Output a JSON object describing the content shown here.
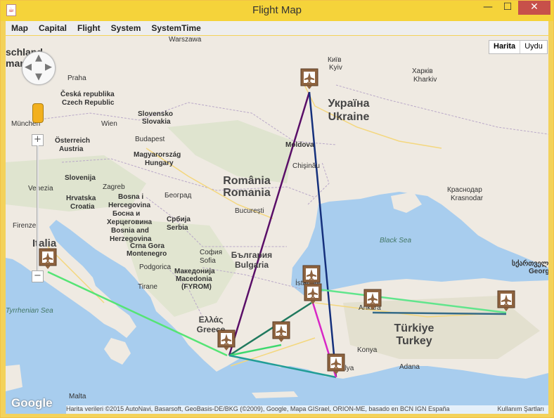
{
  "window": {
    "title": "Flight Map",
    "app_icon": "java-icon"
  },
  "menu": [
    "Map",
    "Capital",
    "Flight",
    "System",
    "SystemTime"
  ],
  "map_type": {
    "map_label": "Harita",
    "satellite_label": "Uydu"
  },
  "google_logo": "Google",
  "attribution": "Harita verileri ©2015 AutoNavi, Basarsoft, GeoBasis-DE/BKG (©2009), Google, Mapa GISrael, ORION-ME, basado en BCN IGN España",
  "terms": "Kullanım Şartları",
  "countries": [
    {
      "l1": "Україна",
      "l2": "Ukraine"
    },
    {
      "l1": "România",
      "l2": "Romania"
    },
    {
      "l1": "България",
      "l2": "Bulgaria"
    },
    {
      "l1": "Türkiye",
      "l2": "Turkey"
    },
    {
      "l1": "Ελλάς",
      "l2": "Greece"
    },
    {
      "l1": "Italia",
      "l2": ""
    }
  ],
  "cities": [
    "Warszawa",
    "Київ",
    "Kyiv",
    "Харків",
    "Kharkiv",
    "Praha",
    "Česká republika",
    "Czech Republic",
    "Slovensko",
    "Slovakia",
    "Wien",
    "Österreich",
    "Austria",
    "München",
    "Budapest",
    "Magyarország",
    "Hungary",
    "Moldova",
    "Chişinău",
    "Slovenija",
    "Zagreb",
    "Hrvatska",
    "Croatia",
    "Bosna i",
    "Hercegovina",
    "Босна и",
    "Херцеговина",
    "Bosnia and",
    "Herzegovina",
    "Београд",
    "Србија",
    "Serbia",
    "Crna Gora",
    "Montenegro",
    "Podgorica",
    "București",
    "Краснодар",
    "Krasnodar",
    "Black Sea",
    "София",
    "Sofia",
    "Македонија",
    "Macedonia",
    "(FYROM)",
    "Tirane",
    "Venezia",
    "Firenze",
    "İstanbul",
    "Ankara",
    "Konya",
    "Antalya",
    "Adana",
    "Malta",
    "Tyrrhenian Sea",
    "Georgia",
    "სქართველო",
    "schland",
    "many"
  ],
  "airports": [
    "Kyiv",
    "Roma",
    "İstanbul",
    "İstanbul",
    "Ankara",
    "Erzurum",
    "İzmir",
    "Atina",
    "Antalya"
  ],
  "flights": [
    {
      "from": "Kyiv",
      "to": "Atina",
      "color": "#5a0f68"
    },
    {
      "from": "Kyiv",
      "to": "Antalya",
      "color": "#15307c"
    },
    {
      "from": "Roma",
      "to": "Atina",
      "color": "#55e475"
    },
    {
      "from": "Atina",
      "to": "İstanbul",
      "color": "#20795e"
    },
    {
      "from": "Atina",
      "to": "İzmir",
      "color": "#3dd86e"
    },
    {
      "from": "Atina",
      "to": "Antalya",
      "color": "#219d96"
    },
    {
      "from": "İstanbul",
      "to": "Antalya",
      "color": "#d826c6"
    },
    {
      "from": "İstanbul",
      "to": "Erzurum",
      "color": "#61e58c"
    },
    {
      "from": "Ankara",
      "to": "Erzurum",
      "color": "#346a88"
    }
  ]
}
